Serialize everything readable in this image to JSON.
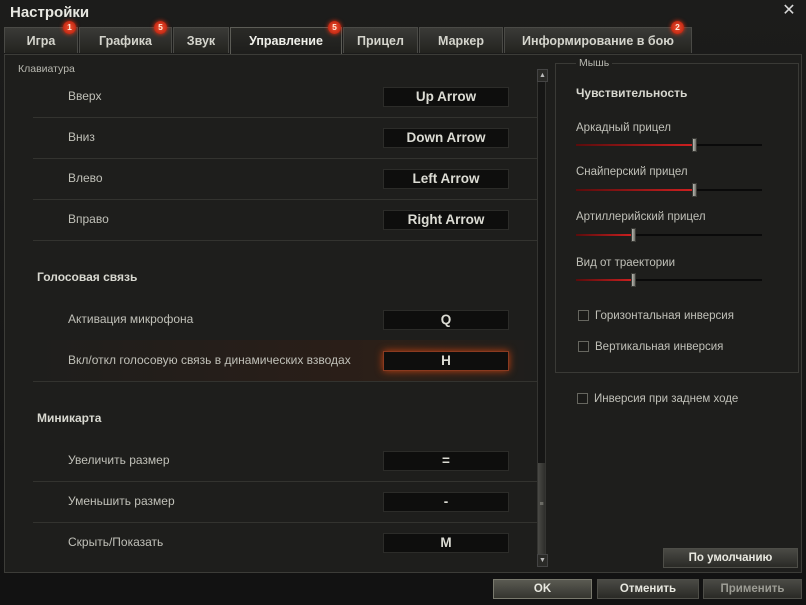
{
  "window": {
    "title": "Настройки",
    "close": "✕"
  },
  "tabs": [
    {
      "label": "Игра",
      "badge": "1"
    },
    {
      "label": "Графика",
      "badge": "5"
    },
    {
      "label": "Звук",
      "badge": ""
    },
    {
      "label": "Управление",
      "badge": "5"
    },
    {
      "label": "Прицел",
      "badge": ""
    },
    {
      "label": "Маркер",
      "badge": ""
    },
    {
      "label": "Информирование в бою",
      "badge": "2"
    }
  ],
  "active_tab": "Управление",
  "keyboard": {
    "group_label": "Клавиатура",
    "movement": [
      {
        "label": "Вверх",
        "key": "Up Arrow"
      },
      {
        "label": "Вниз",
        "key": "Down Arrow"
      },
      {
        "label": "Влево",
        "key": "Left Arrow"
      },
      {
        "label": "Вправо",
        "key": "Right Arrow"
      }
    ],
    "voice": {
      "title": "Голосовая связь",
      "rows": [
        {
          "label": "Активация микрофона",
          "key": "Q"
        },
        {
          "label": "Вкл/откл голосовую связь в динамических взводах",
          "key": "H"
        }
      ]
    },
    "minimap": {
      "title": "Миникарта",
      "rows": [
        {
          "label": "Увеличить размер",
          "key": "="
        },
        {
          "label": "Уменьшить размер",
          "key": "-"
        },
        {
          "label": "Скрыть/Показать",
          "key": "M"
        }
      ]
    }
  },
  "mouse": {
    "group_label": "Мышь",
    "sensitivity_title": "Чувствительность",
    "sliders": [
      {
        "label": "Аркадный прицел",
        "value_fraction": 0.64
      },
      {
        "label": "Снайперский прицел",
        "value_fraction": 0.64
      },
      {
        "label": "Артиллерийский прицел",
        "value_fraction": 0.31
      },
      {
        "label": "Вид от траектории",
        "value_fraction": 0.31
      }
    ],
    "checkboxes": [
      {
        "label": "Горизонтальная инверсия",
        "checked": false
      },
      {
        "label": "Вертикальная инверсия",
        "checked": false
      }
    ]
  },
  "reverse_inversion": {
    "label": "Инверсия при заднем ходе",
    "checked": false
  },
  "buttons": {
    "default": "По умолчанию",
    "ok": "OK",
    "cancel": "Отменить",
    "apply": "Применить"
  },
  "colors": {
    "accent_red": "#d02020",
    "badge": "#e03a1c",
    "highlight": "#c04010"
  }
}
